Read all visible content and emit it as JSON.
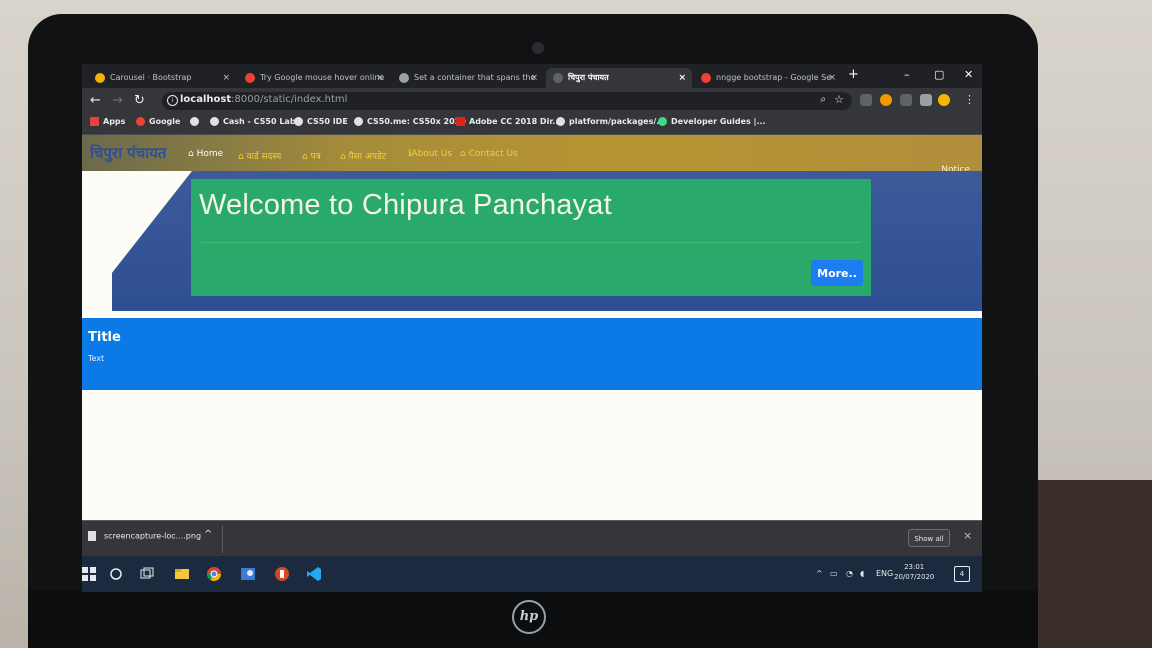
{
  "browser": {
    "tabs": [
      {
        "label": "Carousel · Bootstrap",
        "active": false
      },
      {
        "label": "Try Google mouse hover online",
        "active": false
      },
      {
        "label": "Set a container that spans the",
        "active": false
      },
      {
        "label": "चिपुरा पंचायत",
        "active": true
      },
      {
        "label": "nngge bootstrap - Google Se",
        "active": false
      }
    ],
    "new_tab": "+",
    "close_glyph": "×",
    "window_controls": [
      "–",
      "▢",
      "✕"
    ],
    "url_host": "localhost",
    "url_path": ":8000/static/index.html",
    "bookmarks": [
      "Apps",
      "Google",
      "Cash - CS50 Lab",
      "CS50 IDE",
      "CS50.me: CS50x 2020",
      "Adobe CC 2018 Dir...",
      "platform/packages/...",
      "Developer Guides |..."
    ]
  },
  "page": {
    "brand": "चिपुरा पंचायत",
    "nav": [
      "Home",
      "वार्ड सदस्य",
      "पत्र",
      "पैसा अपडेट",
      "About Us",
      "Contact Us"
    ],
    "notice": "Notice",
    "jumbotron_title": "Welcome to Chipura Panchayat",
    "more_button": "More..",
    "card_title": "Title",
    "card_text": "Text"
  },
  "download_shelf": {
    "filename": "screencapture-loc....png",
    "show_all": "Show all",
    "close": "×"
  },
  "taskbar": {
    "lang": "ENG",
    "time": "23:01",
    "date": "20/07/2020",
    "notifications": "4"
  },
  "colors": {
    "navbar": "#b89533",
    "jumbotron": "#29a96a",
    "card": "#0b7ae6",
    "more_button": "#1d7cf2"
  }
}
